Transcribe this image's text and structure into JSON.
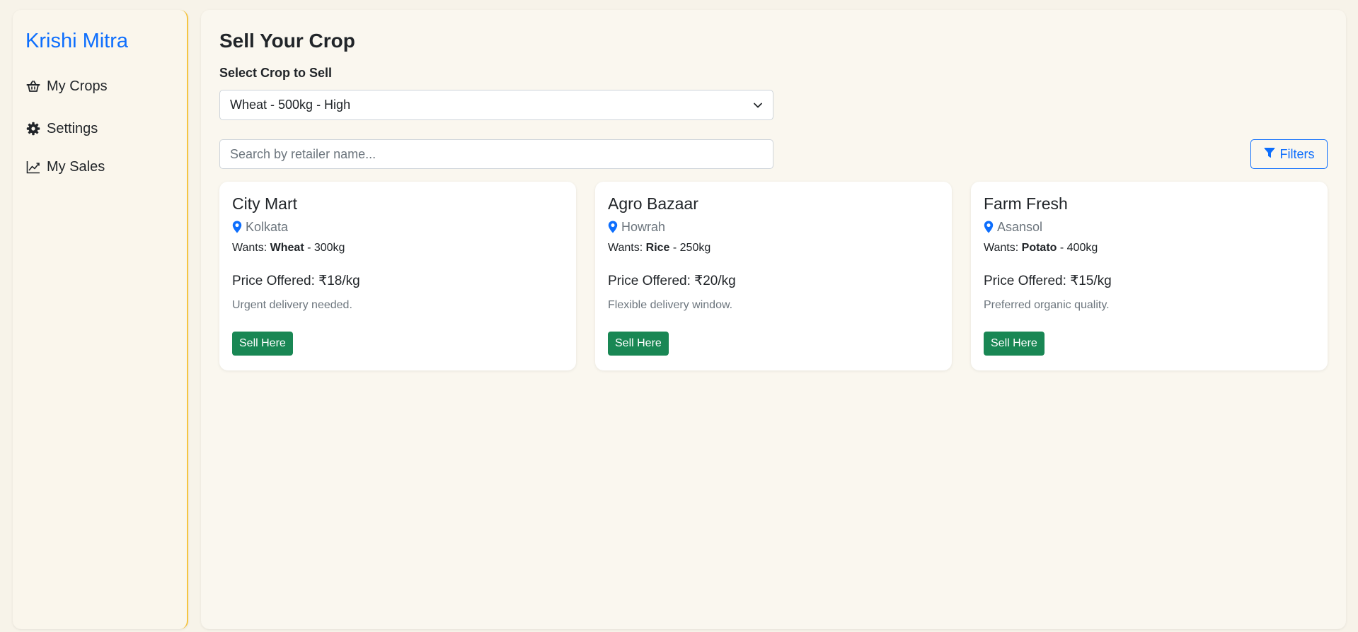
{
  "app": {
    "brand": "Krishi Mitra"
  },
  "sidebar": {
    "items": [
      {
        "label": "My Crops",
        "icon": "basket-icon"
      },
      {
        "label": "Settings",
        "icon": "gear-icon"
      },
      {
        "label": "My Sales",
        "icon": "chart-line-icon"
      }
    ]
  },
  "main": {
    "title": "Sell Your Crop",
    "select_label": "Select Crop to Sell",
    "selected_crop": "Wheat - 500kg - High",
    "search": {
      "placeholder": "Search by retailer name...",
      "value": ""
    },
    "filters_label": "Filters"
  },
  "retailers": [
    {
      "name": "City Mart",
      "location": "Kolkata",
      "wants_prefix": "Wants: ",
      "wants_crop": "Wheat",
      "wants_qty": " - 300kg",
      "price": "Price Offered: ₹18/kg",
      "note": "Urgent delivery needed.",
      "button": "Sell Here"
    },
    {
      "name": "Agro Bazaar",
      "location": "Howrah",
      "wants_prefix": "Wants: ",
      "wants_crop": "Rice",
      "wants_qty": " - 250kg",
      "price": "Price Offered: ₹20/kg",
      "note": "Flexible delivery window.",
      "button": "Sell Here"
    },
    {
      "name": "Farm Fresh",
      "location": "Asansol",
      "wants_prefix": "Wants: ",
      "wants_crop": "Potato",
      "wants_qty": " - 400kg",
      "price": "Price Offered: ₹15/kg",
      "note": "Preferred organic quality.",
      "button": "Sell Here"
    }
  ],
  "colors": {
    "accent": "#0d6efd",
    "success": "#198754",
    "sidebar_border": "#f5c542",
    "background": "#f7f3e9"
  }
}
